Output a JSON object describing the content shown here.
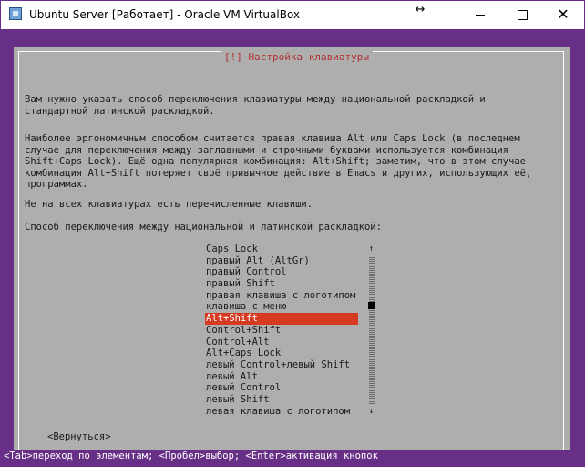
{
  "window": {
    "title": "Ubuntu Server [Работает] - Oracle VM VirtualBox",
    "icons": {
      "app": "virtualbox-icon",
      "resize": "resize-icon"
    },
    "controls": {
      "minimize": "minimize",
      "maximize": "maximize",
      "close": "✕"
    }
  },
  "dialog": {
    "title": "[!] Настройка клавиатуры",
    "paragraphs": [
      "Вам нужно указать способ переключения клавиатуры между национальной раскладкой и\nстандартной латинской раскладкой.",
      "Наиболее эргономичным способом считается правая клавиша Alt или Caps Lock (в последнем\nслучае для переключения между заглавными и строчными буквами используется комбинация\nShift+Caps Lock). Ещё одна популярная комбинация: Alt+Shift; заметим, что в этом случае\nкомбинация Alt+Shift потеряет своё привычное действие в Emacs и других, использующих её,\nпрограммах.",
      "Не на всех клавиатурах есть перечисленные клавиши.",
      "Способ переключения между национальной и латинской раскладкой:"
    ],
    "options": [
      "Caps Lock",
      "правый Alt (AltGr)",
      "правый Control",
      "правый Shift",
      "правая клавиша с логотипом",
      "клавиша с меню",
      "Alt+Shift",
      "Control+Shift",
      "Control+Alt",
      "Alt+Caps Lock",
      "левый Control+левый Shift",
      "левый Alt",
      "левый Control",
      "левый Shift",
      "левая клавиша с логотипом"
    ],
    "selected_option": "Alt+Shift",
    "scroll_up": "↑",
    "scroll_down": "↓",
    "back_button": "<Вернуться>"
  },
  "statusbar": {
    "text": "<Tab>переход по элементам; <Пробел>выбор; <Enter>активация кнопок"
  },
  "colors": {
    "vm_background": "#672f86",
    "dialog_background": "#aeaeae",
    "selection": "#d63b22",
    "title_text": "#b23030"
  }
}
